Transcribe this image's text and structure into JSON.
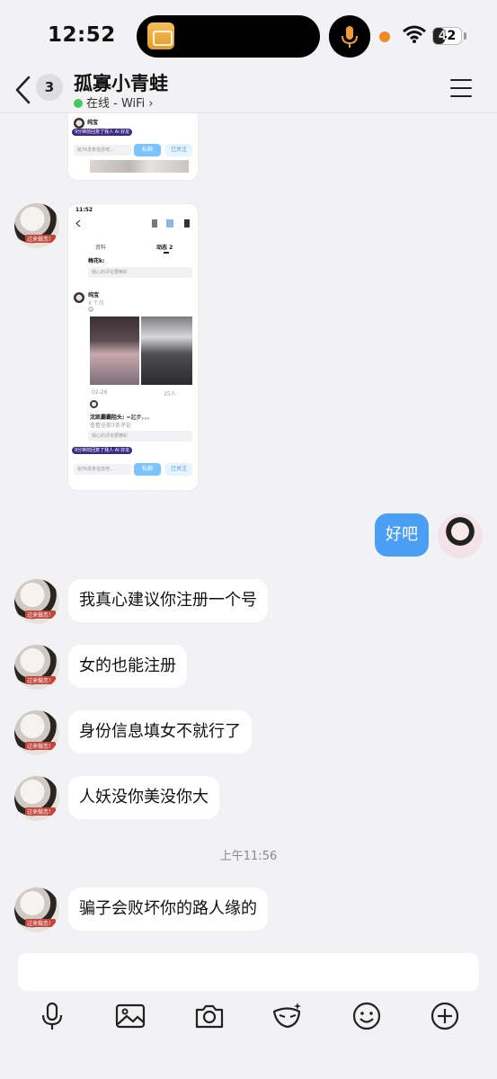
{
  "status_bar": {
    "time": "12:52",
    "battery": "42",
    "battery_level": 0.42
  },
  "header": {
    "back_badge": "3",
    "title": "孤寡小青蛙",
    "presence": "在线 - WiFi",
    "presence_chevron": "›"
  },
  "shared_image_top": {
    "user": "纯宝",
    "pill": "9分钟前回复了我人 AI 好友",
    "input_placeholder": "给TA发条信息吧...",
    "primary_btn": "私聊",
    "secondary_btn": "已关注"
  },
  "shared_image_main": {
    "time": "11:52",
    "tab_profile": "资料",
    "tab_moments": "动态 2",
    "first_post_user": "梅花k:",
    "comment_placeholder": "我心的评论要精彩",
    "post_user": "纯宝",
    "post_meta": "4 个月",
    "post_date": "02-26",
    "post_stats": "25人",
    "comment_user": "沈凯霸霸阻头:",
    "comment_text": "≈起步。。。",
    "view_all": "查看全部3条评论",
    "pill": "9分钟前回复了我人 AI 好友",
    "input_placeholder": "给TA发条信息吧...",
    "primary_btn": "私聊",
    "secondary_btn": "已关注"
  },
  "avatar_tag": "过来做恋！",
  "messages": {
    "me_1": "好吧",
    "them_1": "我真心建议你注册一个号",
    "them_2": "女的也能注册",
    "them_3": "身份信息填女不就行了",
    "them_4": "人妖没你美没你大",
    "timestamp": "上午11:56",
    "them_5": "骗子会败坏你的路人缘的"
  },
  "composer": {
    "placeholder": ""
  },
  "icons": {
    "toolbar": [
      "microphone-icon",
      "image-icon",
      "camera-icon",
      "mask-sparkle-icon",
      "emoji-icon",
      "plus-icon"
    ]
  },
  "colors": {
    "my_bubble": "#4a9ff5",
    "presence_dot": "#3ecb5b",
    "background": "#f2f2f4"
  }
}
